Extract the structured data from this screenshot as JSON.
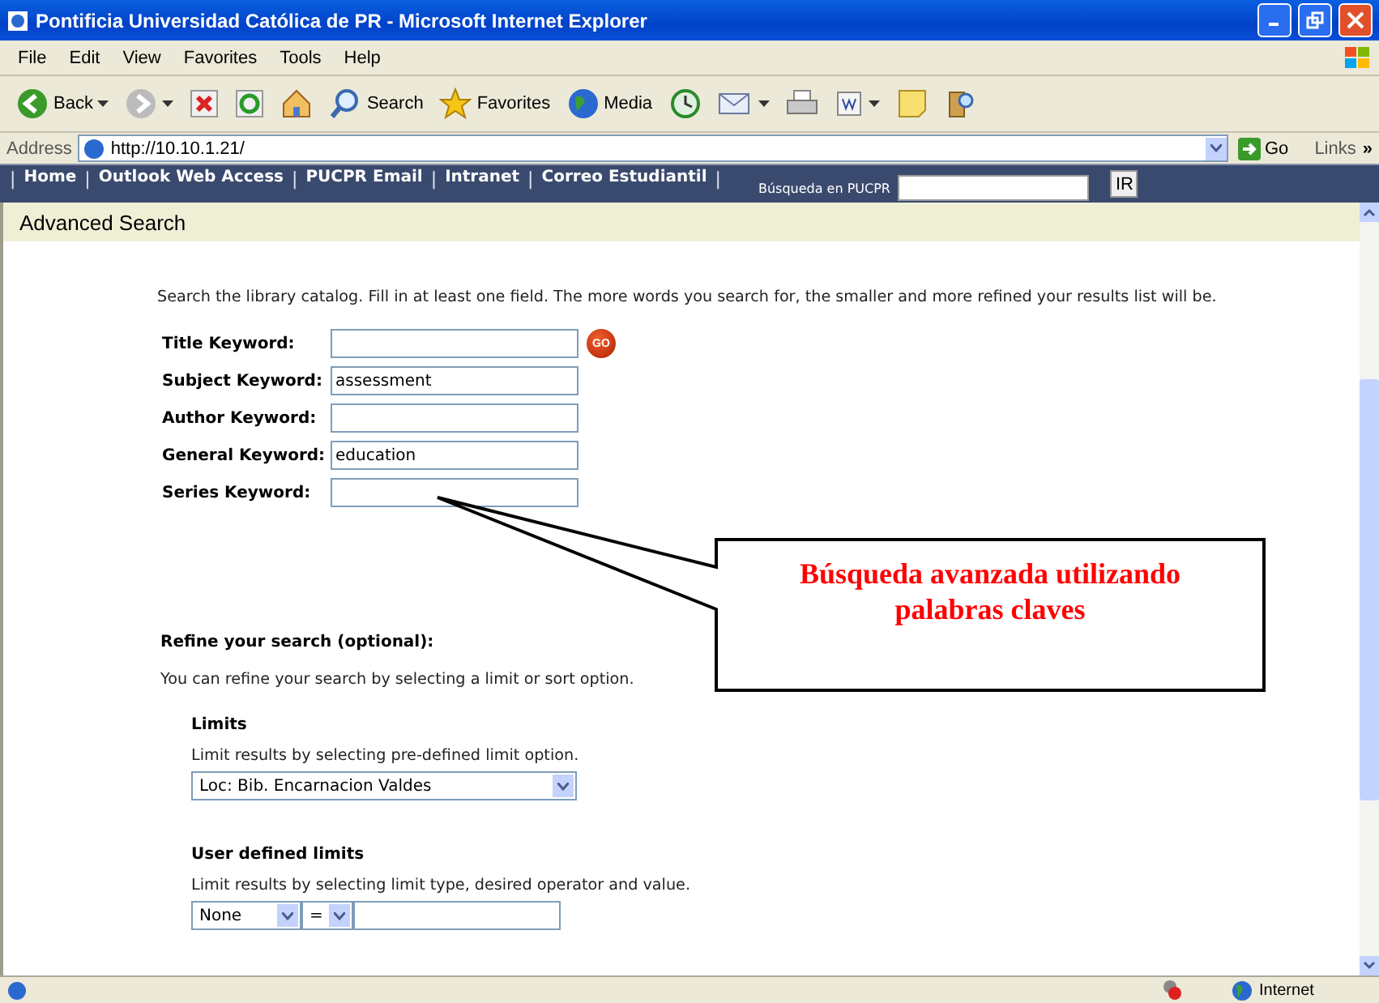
{
  "window": {
    "title": "Pontificia Universidad Católica de PR - Microsoft Internet Explorer"
  },
  "menu": [
    "File",
    "Edit",
    "View",
    "Favorites",
    "Tools",
    "Help"
  ],
  "toolbar": [
    {
      "kind": "back",
      "label": "Back"
    },
    {
      "kind": "forward"
    },
    {
      "kind": "stop"
    },
    {
      "kind": "refresh"
    },
    {
      "kind": "home"
    },
    {
      "kind": "search",
      "label": "Search"
    },
    {
      "kind": "favorites",
      "label": "Favorites"
    },
    {
      "kind": "media",
      "label": "Media"
    },
    {
      "kind": "history"
    },
    {
      "kind": "mail"
    },
    {
      "kind": "print"
    },
    {
      "kind": "edit"
    },
    {
      "kind": "note"
    },
    {
      "kind": "research"
    }
  ],
  "address": {
    "label": "Address",
    "value": "http://10.10.1.21/",
    "go": "Go",
    "links": "Links",
    "more": "»"
  },
  "nav": {
    "items": [
      {
        "kind": "separator",
        "text": "|"
      },
      {
        "kind": "link",
        "text": "Home"
      },
      {
        "kind": "separator",
        "text": "|"
      },
      {
        "kind": "link",
        "text": "Outlook Web Access"
      },
      {
        "kind": "separator",
        "text": "|"
      },
      {
        "kind": "link",
        "text": "PUCPR Email"
      },
      {
        "kind": "separator",
        "text": "|"
      },
      {
        "kind": "link",
        "text": "Intranet"
      },
      {
        "kind": "separator",
        "text": "|"
      },
      {
        "kind": "link",
        "text": "Correo Estudiantil"
      },
      {
        "kind": "separator",
        "text": "|"
      }
    ],
    "search_label": "Búsqueda en PUCPR",
    "search_button": "IR"
  },
  "page": {
    "title": "Advanced Search",
    "intro": "Search the library catalog. Fill in at least one field. The more words you search for, the smaller and more refined your results list will be.",
    "fields": [
      {
        "label": "Title Keyword:",
        "go": "GO"
      },
      {
        "label": "Subject Keyword:",
        "value": "assessment"
      },
      {
        "label": "Author Keyword:"
      },
      {
        "label": "General Keyword:",
        "value": "education"
      },
      {
        "label": "Series Keyword:"
      }
    ],
    "refine_heading": "Refine your search (optional):",
    "refine_text": "You can refine your search by selecting a limit or sort option.",
    "limits_heading": "Limits",
    "limits_text": "Limit results by selecting pre-defined limit option.",
    "limits_value": "Loc: Bib. Encarnacion Valdes",
    "user_heading": "User defined limits",
    "user_text": "Limit results by selecting limit type, desired operator and value.",
    "user_type": "None",
    "user_operator": "="
  },
  "callout": {
    "text": "Búsqueda avanzada utilizando palabras claves"
  },
  "status_bar": {
    "zone": "Internet"
  }
}
